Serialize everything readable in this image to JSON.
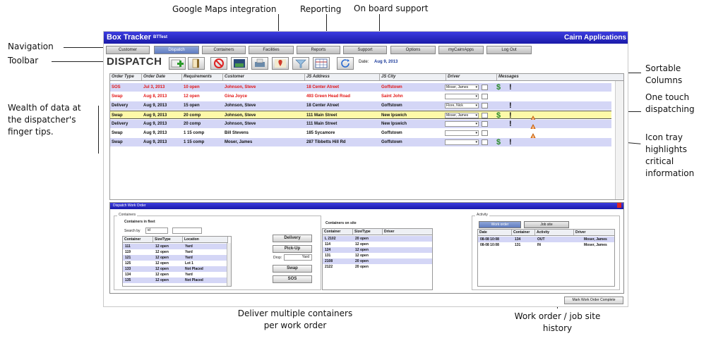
{
  "annotations": {
    "google_maps": "Google Maps integration",
    "reporting": "Reporting",
    "onboard": "On board support",
    "navigation": "Navigation",
    "toolbar": "Toolbar",
    "wealth": "Wealth of data at the dispatcher's finger tips.",
    "sortable": "Sortable Columns",
    "onetouch": "One touch dispatching",
    "icontray": "Icon tray highlights critical information",
    "deliver_multi": "Deliver multiple containers per work order",
    "history": "Work order / job site history"
  },
  "app": {
    "title": "Box Tracker",
    "title_sup": "BTTest",
    "company": "Cairn Applications"
  },
  "nav": {
    "tabs": [
      "Customer",
      "Dispatch",
      "Containers",
      "Facilities",
      "Reports",
      "Support",
      "Options",
      "myCairnApps",
      "Log Out"
    ],
    "active": "Dispatch"
  },
  "toolbar": {
    "title": "DISPATCH",
    "date_label": "Date:",
    "date_value": "Aug 9, 2013",
    "icons": [
      "add-icon",
      "document-icon",
      "cancel-icon",
      "map-icon",
      "printer-icon",
      "map-pin-icon",
      "filter-icon",
      "table-icon",
      "refresh-icon"
    ]
  },
  "grid": {
    "columns": [
      "Order Type",
      "Order Date",
      "Requirements",
      "Customer",
      "JS Address",
      "JS City",
      "Driver",
      "Messages"
    ],
    "rows": [
      {
        "type": "SOS",
        "date": "Jul 3, 2013",
        "req": "10 open",
        "customer": "Johnson, Steve",
        "address": "18 Center Atreet",
        "city": "Goffstown",
        "driver": "Moser, James",
        "dollar": true,
        "bang": true,
        "warn": false,
        "style": "blue",
        "red": true
      },
      {
        "type": "Swap",
        "date": "Aug 8, 2013",
        "req": "12 open",
        "customer": "Gina Joyce",
        "address": "493 Green Head Road",
        "city": "Saint John",
        "driver": "",
        "dollar": false,
        "bang": false,
        "warn": false,
        "style": "white",
        "red": true
      },
      {
        "type": "Delivery",
        "date": "Aug 9, 2013",
        "req": "15 open",
        "customer": "Johnson, Steve",
        "address": "18 Center Atreet",
        "city": "Goffstown",
        "driver": "Flore, Nick",
        "dollar": false,
        "bang": true,
        "warn": false,
        "style": "blue",
        "red": false
      },
      {
        "type": "Swap",
        "date": "Aug 9, 2013",
        "req": "20 comp",
        "customer": "Johnson, Steve",
        "address": "111 Main Street",
        "city": "New Ipswich",
        "driver": "Moser, James",
        "dollar": true,
        "bang": true,
        "warn": true,
        "style": "yellow",
        "red": false
      },
      {
        "type": "Delivery",
        "date": "Aug 9, 2013",
        "req": "20 comp",
        "customer": "Johnson, Steve",
        "address": "111 Main Street",
        "city": "New Ipswich",
        "driver": "",
        "dollar": false,
        "bang": true,
        "warn": true,
        "style": "blue",
        "red": false
      },
      {
        "type": "Swap",
        "date": "Aug 9, 2013",
        "req": "1 15 comp",
        "customer": "Bill Stevens",
        "address": "185 Sycamore",
        "city": "Goffstown",
        "driver": "",
        "dollar": false,
        "bang": false,
        "warn": true,
        "style": "white",
        "red": false
      },
      {
        "type": "Swap",
        "date": "Aug 9, 2013",
        "req": "1 15 comp",
        "customer": "Moser, James",
        "address": "287 Tibbetts Hill Rd",
        "city": "Goffstown",
        "driver": "",
        "dollar": true,
        "bang": true,
        "warn": false,
        "style": "blue",
        "red": false
      }
    ]
  },
  "work_order": {
    "title": "Dispatch Work Order",
    "containers_legend": "Containers",
    "containers_in_fleet": "Containers in fleet",
    "search_by": "Search by",
    "search_by_value": "id",
    "fleet_columns": [
      "Container",
      "Size/Type",
      "Location"
    ],
    "fleet_rows": [
      [
        "111",
        "12 open",
        "Yard"
      ],
      [
        "119",
        "12 open",
        "Yard"
      ],
      [
        "121",
        "12 open",
        "Yard"
      ],
      [
        "125",
        "12 open",
        "Lot 1"
      ],
      [
        "133",
        "12 open",
        "Not Placed"
      ],
      [
        "134",
        "12 open",
        "Yard"
      ],
      [
        "135",
        "12 open",
        "Not Placed"
      ]
    ],
    "buttons": {
      "delivery": "Delivery",
      "pickup": "Pick-Up",
      "drop_label": "Drop:",
      "drop_value": "Yard",
      "swap": "Swap",
      "sos": "SOS"
    },
    "on_site_label": "Containers on site",
    "site_columns": [
      "Container",
      "Size/Type",
      "Driver"
    ],
    "site_rows": [
      [
        "L 2102",
        "20 open",
        ""
      ],
      [
        "114",
        "12 open",
        ""
      ],
      [
        "124",
        "12 open",
        ""
      ],
      [
        "131",
        "12 open",
        ""
      ],
      [
        "2108",
        "20 open",
        ""
      ],
      [
        "2122",
        "20 open",
        ""
      ]
    ],
    "activity_legend": "Activity",
    "activity_tabs": [
      "Work order",
      "Job site"
    ],
    "activity_columns": [
      "Date",
      "Container",
      "Activity",
      "Driver"
    ],
    "activity_rows": [
      [
        "08-08 10:08",
        "134",
        "OUT",
        "Moser, James"
      ],
      [
        "08-08 10:08",
        "131",
        "IN",
        "Moser, James"
      ]
    ],
    "complete_button": "Mark Work Order Complete"
  },
  "colors": {
    "titlebar": "#1a1aa8",
    "row_blue": "#d4d6f6",
    "row_yellow": "#fdf9a8",
    "sos_red": "#e21616",
    "dollar_green": "#2a8a2a",
    "warn_orange": "#e8781a"
  }
}
